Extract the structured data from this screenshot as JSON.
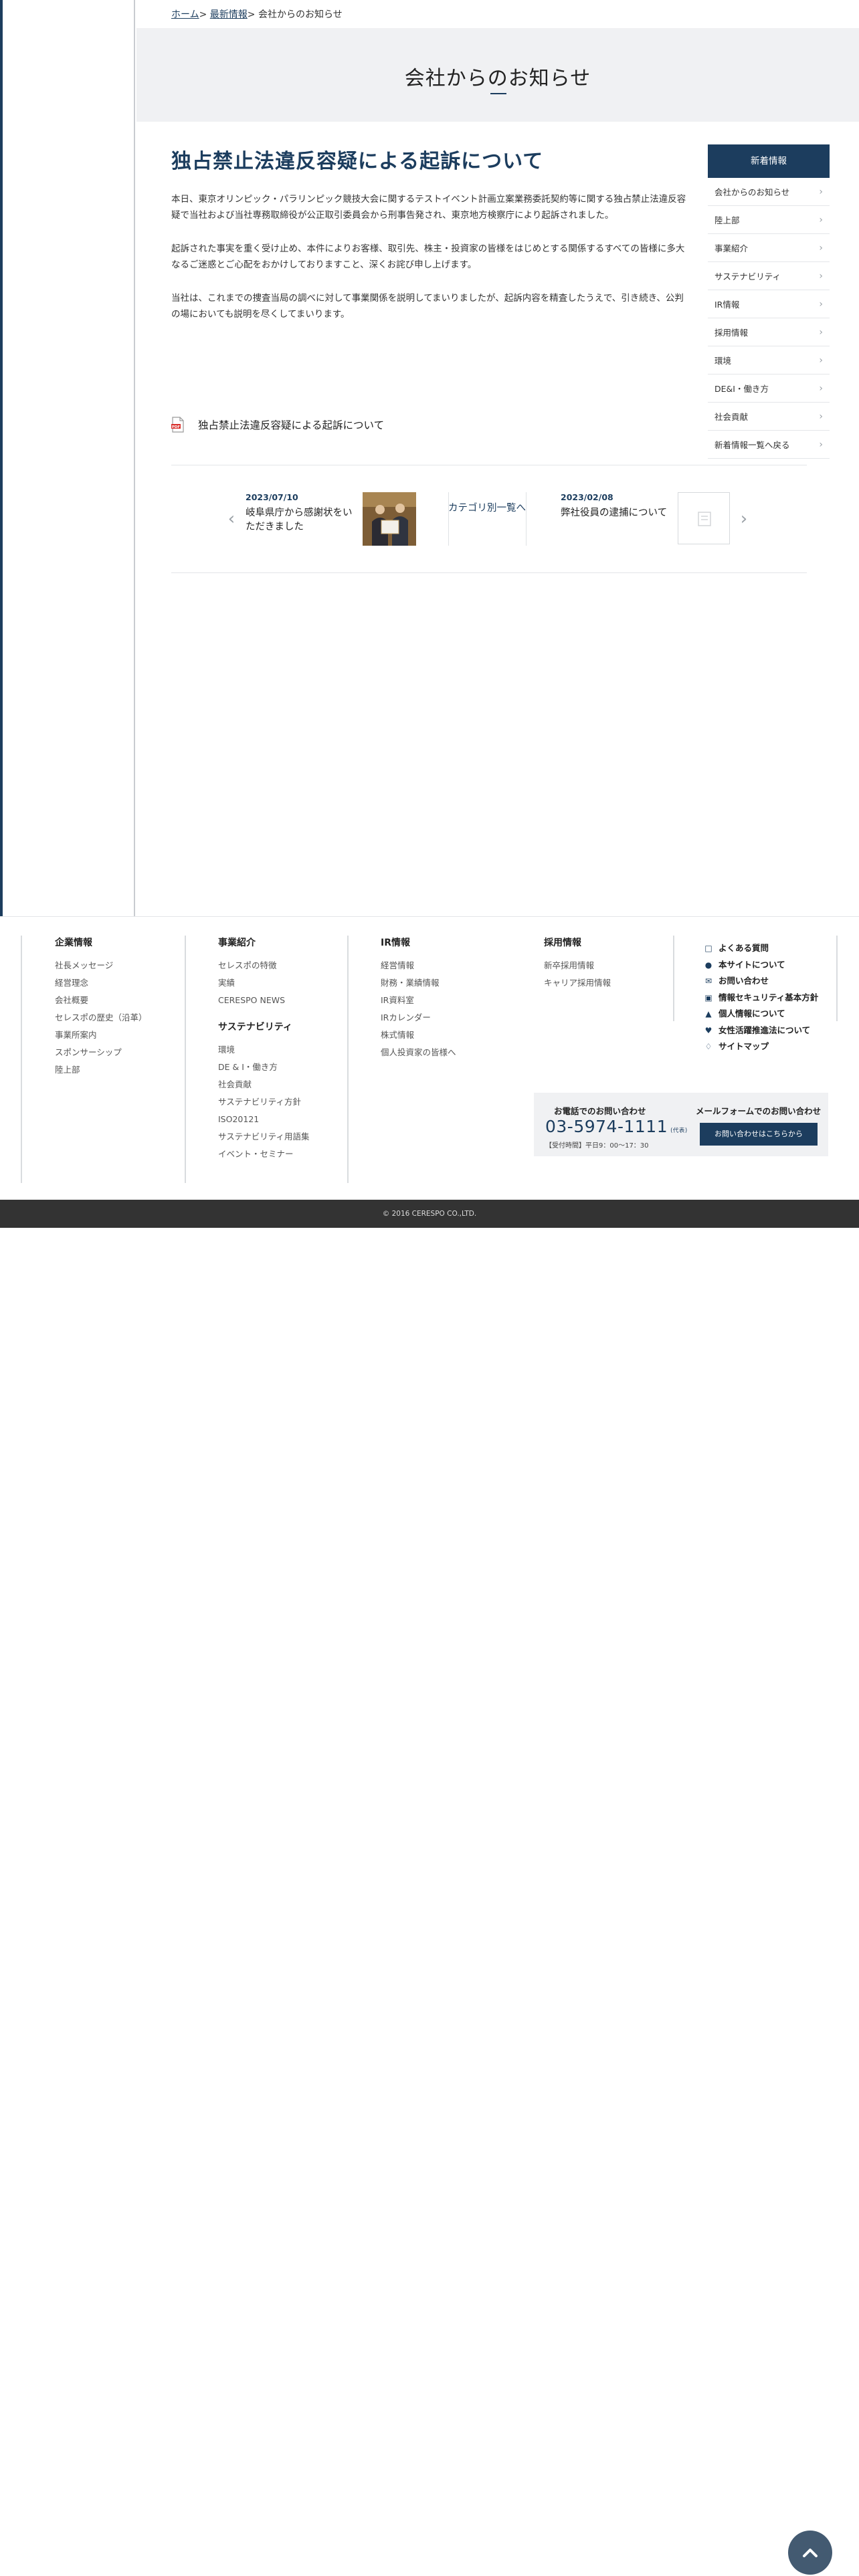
{
  "breadcrumb": {
    "home": "ホーム",
    "sep1": "> ",
    "news": "最新情報",
    "sep2": "> ",
    "current": "会社からのお知らせ"
  },
  "page": {
    "title": "会社からのお知らせ"
  },
  "article": {
    "title": "独占禁止法違反容疑による起訴について",
    "paragraphs": [
      "本日、東京オリンピック・パラリンピック競技大会に関するテストイベント計画立案業務委託契約等に関する独占禁止法違反容疑で当社および当社専務取締役が公正取引委員会から刑事告発され、東京地方検察庁により起訴されました。",
      "起訴された事実を重く受け止め、本件によりお客様、取引先、株主・投資家の皆様をはじめとする関係するすべての皆様に多大なるご迷惑とご心配をおかけしておりますこと、深くお詫び申し上げます。",
      "当社は、これまでの捜査当局の調べに対して事業関係を説明してまいりましたが、起訴内容を精査したうえで、引き続き、公判の場においても説明を尽くしてまいります。"
    ],
    "pdf_link": "独占禁止法違反容疑による起訴について"
  },
  "post_nav": {
    "prev": {
      "date": "2023/07/10",
      "title": "岐阜県庁から感謝状をいただきました"
    },
    "category_link": "カテゴリ別一覧へ",
    "next": {
      "date": "2023/02/08",
      "title": "弊社役員の逮捕について"
    }
  },
  "sidebar": {
    "heading": "新着情報",
    "items": [
      {
        "label": "会社からのお知らせ"
      },
      {
        "label": "陸上部"
      },
      {
        "label": "事業紹介"
      },
      {
        "label": "サステナビリティ"
      },
      {
        "label": "IR情報"
      },
      {
        "label": "採用情報"
      },
      {
        "label": "環境"
      },
      {
        "label": "DE&I・働き方"
      },
      {
        "label": "社会貢献"
      },
      {
        "label": "新着情報一覧へ戻る"
      }
    ]
  },
  "footer": {
    "col1": {
      "heading": "企業情報",
      "links": [
        "社長メッセージ",
        "経営理念",
        "会社概要",
        "セレスポの歴史（沿革）",
        "事業所案内",
        "スポンサーシップ",
        "陸上部"
      ]
    },
    "col2": {
      "heading": "事業紹介",
      "links": [
        "セレスポの特徴",
        "実績",
        "CERESPO NEWS"
      ],
      "heading2": "サステナビリティ",
      "links2": [
        "環境",
        "DE & I・働き方",
        "社会貢献",
        "サステナビリティ方針",
        "ISO20121",
        "サステナビリティ用語集",
        "イベント・セミナー"
      ]
    },
    "col3": {
      "heading": "IR情報",
      "links": [
        "経営情報",
        "財務・業績情報",
        "IR資料室",
        "IRカレンダー",
        "株式情報",
        "個人投資家の皆様へ"
      ]
    },
    "col4": {
      "heading": "採用情報",
      "links": [
        "新卒採用情報",
        "キャリア採用情報"
      ]
    },
    "utility": [
      {
        "icon": "chat-icon",
        "label": "よくある質問"
      },
      {
        "icon": "info-icon",
        "label": "本サイトについて"
      },
      {
        "icon": "mail-icon",
        "label": "お問い合わせ"
      },
      {
        "icon": "lock-icon",
        "label": "情報セキュリティ基本方針"
      },
      {
        "icon": "person-icon",
        "label": "個人情報について"
      },
      {
        "icon": "heart-icon",
        "label": "女性活躍推進法について"
      },
      {
        "icon": "sitemap-icon",
        "label": "サイトマップ"
      }
    ],
    "contact": {
      "tel_label": "お電話でのお問い合わせ",
      "tel": "03-5974-1111",
      "tel_suffix": "(代表)",
      "hours": "【受付時間】平日9：00〜17：30",
      "mail_label": "メールフォームでのお問い合わせ",
      "button": "お問い合わせはこちらから"
    },
    "copyright": "© 2016 CERESPO CO.,LTD."
  },
  "colors": {
    "brand": "#1c3d5e",
    "footer_bar": "#333333",
    "band": "#f0f1f3"
  }
}
